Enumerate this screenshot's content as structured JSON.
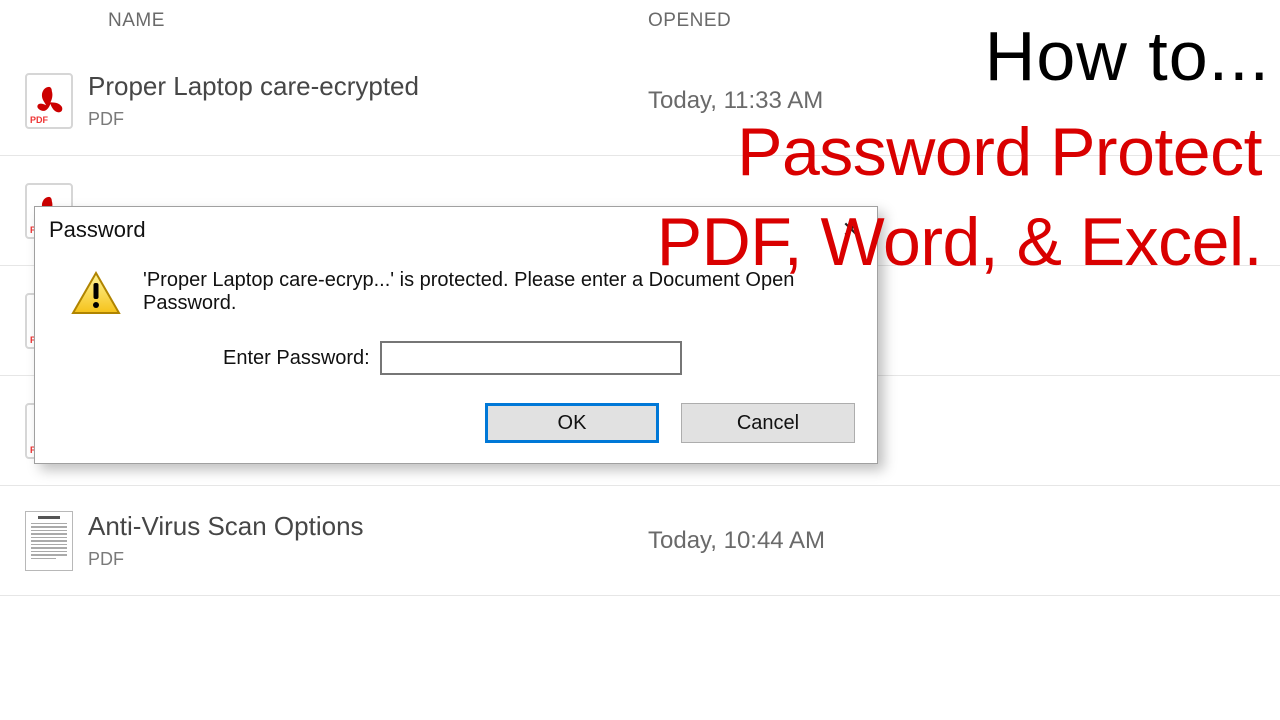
{
  "headers": {
    "name": "NAME",
    "opened": "OPENED"
  },
  "rows": [
    {
      "icon": "pdf",
      "name": "Proper Laptop care-ecrypted",
      "type": "PDF",
      "opened": "Today, 11:33 AM"
    },
    {
      "icon": "pdf",
      "name": "",
      "type": "",
      "opened": ""
    },
    {
      "icon": "pdf",
      "name": "",
      "type": "",
      "opened": ""
    },
    {
      "icon": "pdf",
      "name": "",
      "type": "",
      "opened": ""
    },
    {
      "icon": "doc",
      "name": "Anti-Virus Scan Options",
      "type": "PDF",
      "opened": "Today, 10:44 AM"
    }
  ],
  "dialog": {
    "title": "Password",
    "message": "'Proper Laptop care-ecryp...' is protected. Please enter a Document Open Password.",
    "label": "Enter Password:",
    "input_value": "",
    "ok": "OK",
    "cancel": "Cancel"
  },
  "overlay": {
    "howto": "How to...",
    "line1": "Password Protect",
    "line2": "PDF, Word, & Excel."
  }
}
